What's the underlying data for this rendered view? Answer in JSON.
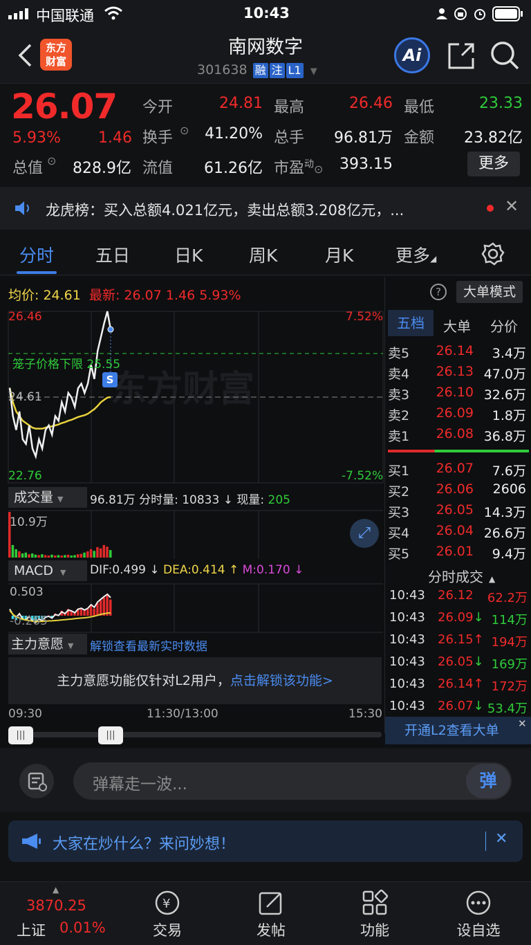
{
  "status_bar": {
    "carrier": "中国联通",
    "time": "10:43"
  },
  "header": {
    "stock_name": "南网数字",
    "code": "301638",
    "tags": [
      "融",
      "注",
      "L1"
    ],
    "logo_text": [
      "东方",
      "财富"
    ],
    "ai_label": "Ai"
  },
  "quote": {
    "price": "26.07",
    "change_pct": "5.93%",
    "change": "1.46",
    "fields": [
      {
        "label": "今开",
        "value": "24.81",
        "color": "red"
      },
      {
        "label": "最高",
        "value": "26.46",
        "color": "red"
      },
      {
        "label": "最低",
        "value": "23.33",
        "color": "green"
      },
      {
        "label": "换手",
        "value": "41.20%",
        "color": "white"
      },
      {
        "label": "总手",
        "value": "96.81万",
        "color": "white"
      },
      {
        "label": "金额",
        "value": "23.82亿",
        "color": "white"
      },
      {
        "label": "总值",
        "value": "828.9亿",
        "color": "white"
      },
      {
        "label": "流值",
        "value": "61.26亿",
        "color": "white"
      },
      {
        "label": "市盈",
        "value": "393.15",
        "color": "white"
      }
    ],
    "pe_superscript": "动",
    "more_label": "更多"
  },
  "news": {
    "text": "龙虎榜：买入总额4.021亿元，卖出总额3.208亿元，..."
  },
  "tabs": [
    "分时",
    "五日",
    "日K",
    "周K",
    "月K",
    "更多"
  ],
  "chart_header": {
    "avg_label": "均价:",
    "avg_value": "24.61",
    "latest_label": "最新:",
    "latest_value": "26.07",
    "latest_change": "1.46",
    "latest_pct": "5.93%",
    "big_order_mode": "大单模式"
  },
  "chart_data": {
    "type": "line",
    "title": "",
    "y_labels": [
      "26.46",
      "24.61",
      "22.76"
    ],
    "pct_labels": [
      "7.52%",
      "-7.52%"
    ],
    "ylim": [
      22.76,
      26.46
    ],
    "limit_label": "笼子价格下限",
    "limit_value": "25.55",
    "x_labels": [
      "09:30",
      "11:30/13:00",
      "15:30"
    ],
    "watermark": "东方财富",
    "price_series": [
      24.81,
      24.2,
      23.9,
      24.3,
      23.7,
      23.6,
      24.0,
      23.5,
      23.33,
      23.7,
      23.5,
      23.9,
      24.0,
      23.8,
      24.2,
      24.1,
      24.5,
      24.3,
      24.7,
      24.6,
      24.4,
      24.8,
      24.9,
      24.7,
      24.9,
      25.3,
      25.0,
      25.6,
      25.9,
      26.2,
      26.46,
      26.07
    ],
    "avg_series": [
      24.81,
      24.5,
      24.3,
      24.2,
      24.1,
      24.05,
      24.0,
      23.95,
      23.93,
      23.93,
      23.93,
      23.95,
      23.97,
      23.98,
      24.0,
      24.02,
      24.05,
      24.07,
      24.1,
      24.12,
      24.15,
      24.18,
      24.2,
      24.22,
      24.25,
      24.3,
      24.35,
      24.42,
      24.5,
      24.55,
      24.6,
      24.61
    ],
    "volume_series": [
      10.9,
      3,
      2,
      1.5,
      1,
      1.2,
      0.8,
      1,
      0.7,
      0.6,
      0.8,
      0.6,
      0.5,
      0.7,
      0.5,
      0.6,
      0.5,
      0.6,
      0.7,
      0.5,
      0.6,
      0.8,
      0.9,
      1.2,
      1.5,
      2,
      1.6,
      2.5,
      2.2,
      3,
      2.6,
      1.8
    ],
    "volume_max_label": "10.9万",
    "macd_max_label": "0.503",
    "macd_min_label": "-0.265"
  },
  "order_book": {
    "tabs": [
      "五档",
      "大单",
      "分价"
    ],
    "asks": [
      {
        "label": "卖5",
        "price": "26.14",
        "vol": "3.4万"
      },
      {
        "label": "卖4",
        "price": "26.13",
        "vol": "47.0万"
      },
      {
        "label": "卖3",
        "price": "26.10",
        "vol": "32.6万"
      },
      {
        "label": "卖2",
        "price": "26.09",
        "vol": "1.8万"
      },
      {
        "label": "卖1",
        "price": "26.08",
        "vol": "36.8万"
      }
    ],
    "bids": [
      {
        "label": "买1",
        "price": "26.07",
        "vol": "7.6万"
      },
      {
        "label": "买2",
        "price": "26.06",
        "vol": "2606"
      },
      {
        "label": "买3",
        "price": "26.05",
        "vol": "14.3万"
      },
      {
        "label": "买4",
        "price": "26.04",
        "vol": "26.6万"
      },
      {
        "label": "买5",
        "price": "26.01",
        "vol": "9.4万"
      }
    ],
    "ticks_header": "分时成交",
    "ticks": [
      {
        "time": "10:43",
        "price": "26.12",
        "arrow": "",
        "vol": "62.2万",
        "color": "red"
      },
      {
        "time": "10:43",
        "price": "26.09",
        "arrow": "↓",
        "vol": "114万",
        "color": "green"
      },
      {
        "time": "10:43",
        "price": "26.15",
        "arrow": "↑",
        "vol": "194万",
        "color": "red"
      },
      {
        "time": "10:43",
        "price": "26.05",
        "arrow": "↓",
        "vol": "169万",
        "color": "green"
      },
      {
        "time": "10:43",
        "price": "26.14",
        "arrow": "↑",
        "vol": "172万",
        "color": "red"
      },
      {
        "time": "10:43",
        "price": "26.07",
        "arrow": "↓",
        "vol": "53.4万",
        "color": "green"
      }
    ],
    "l2_banner": "开通L2查看大单"
  },
  "volume_bar": {
    "label": "成交量",
    "total": "96.81万",
    "fenshi_label": "分时量:",
    "fenshi_value": "10833 ↓",
    "now_label": "现量:",
    "now_value": "205"
  },
  "macd_bar": {
    "label": "MACD",
    "dif": "DIF:0.499 ↓",
    "dea": "DEA:0.414 ↑",
    "m": "M:0.170 ↓"
  },
  "zhuli": {
    "label": "主力意愿",
    "unlock": "解锁查看最新实时数据",
    "notice": "主力意愿功能仅针对L2用户，",
    "notice_link": "点击解锁该功能>"
  },
  "danmu": {
    "placeholder": "弹幕走一波...",
    "send": "弹"
  },
  "banner": {
    "text": "大家在炒什么？来问妙想！"
  },
  "bottom_nav": {
    "index_value": "3870.25",
    "index_name": "上证",
    "index_pct": "0.01%",
    "items": [
      "交易",
      "发帖",
      "功能",
      "设自选"
    ]
  }
}
